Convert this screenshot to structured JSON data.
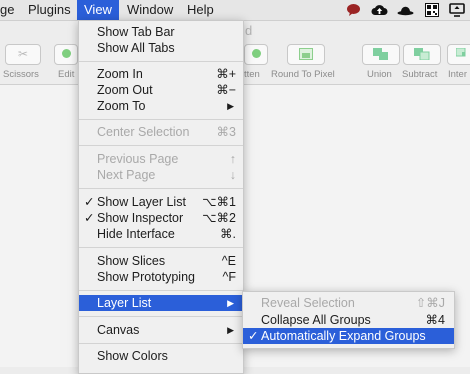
{
  "menubar": {
    "items": [
      {
        "label": "ge",
        "selected": false
      },
      {
        "label": "Plugins",
        "selected": false
      },
      {
        "label": "View",
        "selected": true
      },
      {
        "label": "Window",
        "selected": false
      },
      {
        "label": "Help",
        "selected": false
      }
    ],
    "status_icons": [
      "speech-bubble-icon",
      "cloud-upload-icon",
      "bowler-hat-icon",
      "qr-code-icon",
      "screen-share-icon"
    ]
  },
  "window": {
    "title_fragment": "d"
  },
  "toolbar": {
    "items": [
      {
        "label": "Scissors",
        "icon": "scissors-icon"
      },
      {
        "label": "Edit",
        "icon": "edit-icon"
      },
      {
        "label": "tten",
        "icon": "flatten-icon"
      },
      {
        "label": "Round To Pixel",
        "icon": "round-to-pixel-icon"
      },
      {
        "label": "Union",
        "icon": "union-icon"
      },
      {
        "label": "Subtract",
        "icon": "subtract-icon"
      },
      {
        "label": "Inter",
        "icon": "intersect-icon"
      }
    ]
  },
  "view_menu": {
    "items": [
      {
        "label": "Show Tab Bar",
        "shortcut": "",
        "checked": false,
        "disabled": false
      },
      {
        "label": "Show All Tabs",
        "shortcut": "",
        "checked": false,
        "disabled": false
      },
      {
        "label": "Zoom In",
        "shortcut": "⌘+",
        "checked": false,
        "disabled": false
      },
      {
        "label": "Zoom Out",
        "shortcut": "⌘−",
        "checked": false,
        "disabled": false
      },
      {
        "label": "Zoom To",
        "shortcut": "",
        "submenu": true,
        "checked": false,
        "disabled": false
      },
      {
        "label": "Center Selection",
        "shortcut": "⌘3",
        "checked": false,
        "disabled": true
      },
      {
        "label": "Previous Page",
        "shortcut": "↑",
        "checked": false,
        "disabled": true
      },
      {
        "label": "Next Page",
        "shortcut": "↓",
        "checked": false,
        "disabled": true
      },
      {
        "label": "Show Layer List",
        "shortcut": "⌥⌘1",
        "checked": true,
        "disabled": false
      },
      {
        "label": "Show Inspector",
        "shortcut": "⌥⌘2",
        "checked": true,
        "disabled": false
      },
      {
        "label": "Hide Interface",
        "shortcut": "⌘.",
        "checked": false,
        "disabled": false
      },
      {
        "label": "Show Slices",
        "shortcut": "^E",
        "checked": false,
        "disabled": false
      },
      {
        "label": "Show Prototyping",
        "shortcut": "^F",
        "checked": false,
        "disabled": false
      },
      {
        "label": "Layer List",
        "shortcut": "",
        "submenu": true,
        "highlighted": true,
        "checked": false,
        "disabled": false
      },
      {
        "label": "Canvas",
        "shortcut": "",
        "submenu": true,
        "checked": false,
        "disabled": false
      },
      {
        "label": "Show Colors",
        "shortcut": "",
        "checked": false,
        "disabled": false
      }
    ]
  },
  "layer_list_submenu": {
    "items": [
      {
        "label": "Reveal Selection",
        "shortcut": "⇧⌘J",
        "checked": false,
        "disabled": true
      },
      {
        "label": "Collapse All Groups",
        "shortcut": "⌘4",
        "checked": false,
        "disabled": false
      },
      {
        "label": "Automatically Expand Groups",
        "shortcut": "",
        "checked": true,
        "disabled": false,
        "highlighted": true
      }
    ]
  },
  "colors": {
    "accent": "#2b5fd9"
  }
}
